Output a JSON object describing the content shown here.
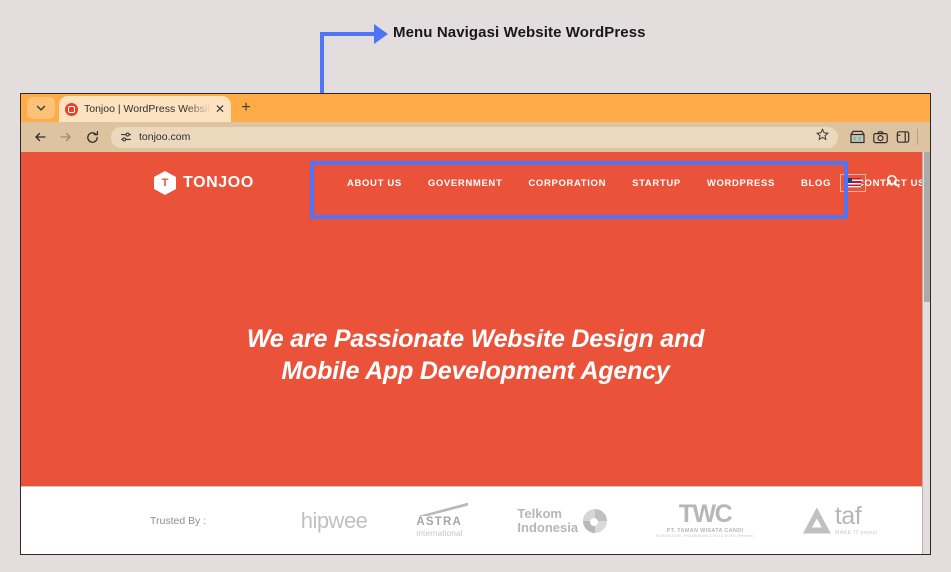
{
  "annotation": {
    "label": "Menu Navigasi Website WordPress",
    "box_color": "#4f74f5"
  },
  "browser": {
    "tab_search_icon": "chevron-down-icon",
    "tab": {
      "favicon": "tonjoo-favicon",
      "title": "Tonjoo | WordPress Website De",
      "close_icon": "close-icon"
    },
    "new_tab_label": "+",
    "toolbar": {
      "back_icon": "back-arrow-icon",
      "forward_icon": "forward-arrow-icon",
      "reload_icon": "reload-icon",
      "site_info_icon": "site-settings-icon",
      "url": "tonjoo.com",
      "bookmark_icon": "star-icon",
      "extension_icon": "extensions-icon",
      "screenshot_icon": "camera-icon",
      "sidepanel_icon": "side-panel-icon"
    }
  },
  "site": {
    "brand": {
      "mark_letter": "T",
      "name": "TONJOO",
      "logo_icon": "tonjoo-hexagon-icon"
    },
    "nav_items": [
      {
        "label": "ABOUT US"
      },
      {
        "label": "GOVERNMENT"
      },
      {
        "label": "CORPORATION"
      },
      {
        "label": "STARTUP"
      },
      {
        "label": "WORDPRESS"
      },
      {
        "label": "BLOG"
      },
      {
        "label": "CONTACT US"
      }
    ],
    "actions": {
      "language_icon": "us-flag-icon",
      "search_icon": "search-icon"
    },
    "hero": {
      "line1": "We are Passionate Website Design and",
      "line2": "Mobile App Development Agency",
      "background_color": "#ea533a"
    },
    "trusted": {
      "label": "Trusted By :",
      "logos": [
        {
          "name": "hipwee",
          "text": "hipwee"
        },
        {
          "name": "astra-international",
          "text": "ASTRA",
          "subtext": "international"
        },
        {
          "name": "telkom-indonesia",
          "text": "Telkom",
          "subtext": "Indonesia"
        },
        {
          "name": "twc",
          "text": "TWC",
          "subtext": "PT. TAMAN WISATA CANDI",
          "subtext2": "BOROBUDUR, PRAMBANAN & RATU BOKO (Persero)"
        },
        {
          "name": "taf",
          "text": "taf",
          "subtext": "MAKE IT yours!"
        }
      ]
    }
  }
}
